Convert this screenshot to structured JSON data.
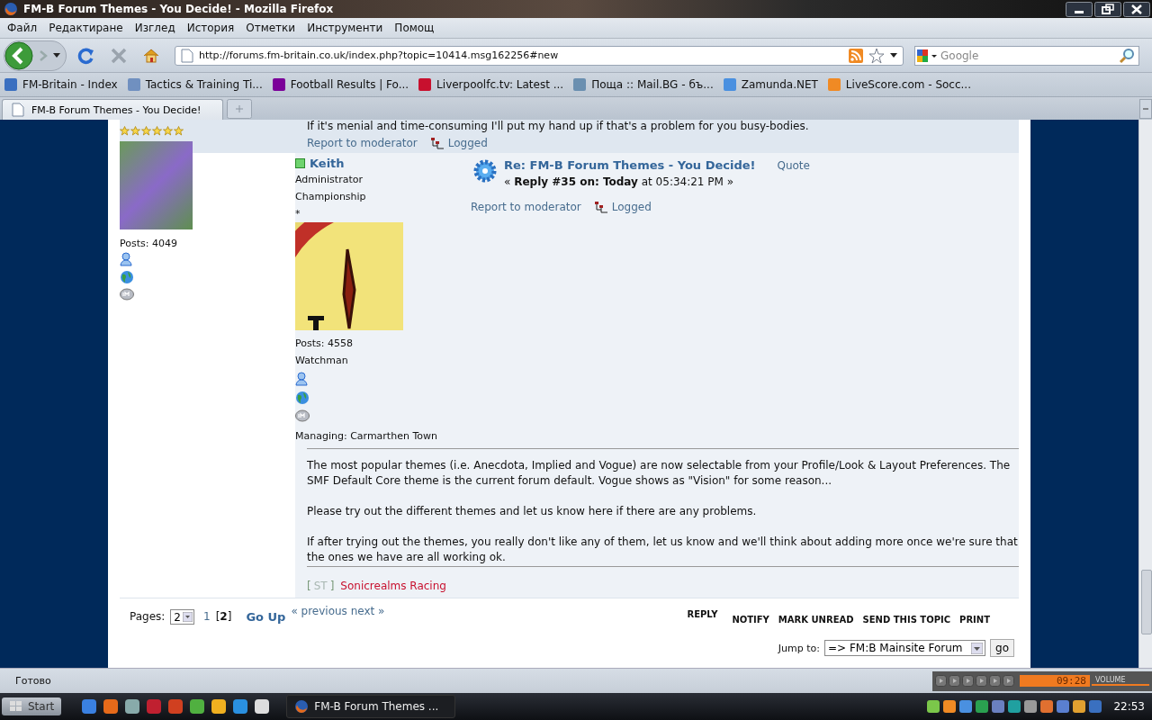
{
  "window": {
    "title": "FM-B Forum Themes - You Decide! - Mozilla Firefox"
  },
  "menu": [
    "Файл",
    "Редактиране",
    "Изглед",
    "История",
    "Отметки",
    "Инструменти",
    "Помощ"
  ],
  "navigation": {
    "url": "http://forums.fm-britain.co.uk/index.php?topic=10414.msg162256#new",
    "search_placeholder": "Google"
  },
  "bookmarks": [
    {
      "label": "FM-Britain - Index"
    },
    {
      "label": "Tactics & Training Ti..."
    },
    {
      "label": "Football Results | Fo..."
    },
    {
      "label": "Liverpoolfc.tv: Latest ..."
    },
    {
      "label": "Поща :: Mail.BG - бъ..."
    },
    {
      "label": "Zamunda.NET"
    },
    {
      "label": "LiveScore.com - Socc..."
    }
  ],
  "tabs": [
    {
      "label": "FM-B Forum Themes - You Decide!",
      "selected": true
    }
  ],
  "previous_post": {
    "stars": 6,
    "avatar_posts": "Posts: 4049",
    "text": "If it's menial and time-consuming I'll put my hand up if that's a problem for you busy-bodies.",
    "report": "Report to moderator",
    "logged": "Logged"
  },
  "post": {
    "author": "Keith",
    "online": true,
    "group": "Administrator",
    "rank": "Championship",
    "rank_stars": "*",
    "posts": "Posts: 4558",
    "personal_text": "Watchman",
    "managing": "Managing: Carmarthen Town",
    "title": "Re: FM-B Forum Themes - You Decide!",
    "meta": "« **Reply #35 on: Today** at 05:34:21 PM »",
    "quote": "Quote",
    "report": "Report to moderator",
    "logged": "Logged",
    "body": [
      "The most popular themes (i.e. Anecdota, Implied and Vogue) are now selectable from your Profile/Look & Layout Preferences.  The SMF Default Core theme is the current forum default.  Vogue shows as \"Vision\" for some reason...",
      "Please try out the different themes and let us know here if there are any problems.",
      "If after trying out the themes, you really don't like any of them, let us know and we'll think about adding more once we're sure that the ones we have are all working ok."
    ],
    "signature": {
      "open": "[",
      "faint": "ST",
      "close": "]",
      "link": "Sonicrealms Racing"
    }
  },
  "pagination": {
    "label": "Pages:",
    "select_value": "2",
    "pages": [
      {
        "label": "1",
        "selected": false
      },
      {
        "label": "2",
        "selected": true
      }
    ],
    "current_open": "[",
    "current_close": "]",
    "go_up": "Go Up",
    "prev_next": "« previous next »"
  },
  "actions": [
    "REPLY",
    "NOTIFY",
    "MARK UNREAD",
    "SEND THIS TOPIC",
    "PRINT"
  ],
  "jump": {
    "label": "Jump to:",
    "value": "=> FM:B Mainsite Forum",
    "button": "go"
  },
  "status_bar": {
    "text": "Готово",
    "player_time": "09:28",
    "volume_label": "VOLUME"
  },
  "taskbar": {
    "start": "Start",
    "window": "FM-B Forum Themes ...",
    "clock": "22:53"
  }
}
